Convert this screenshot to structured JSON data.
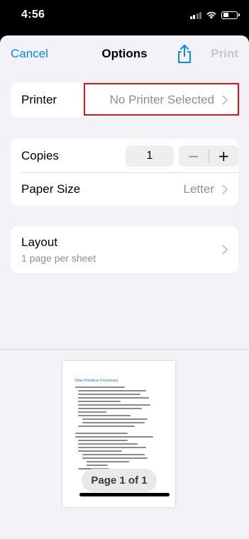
{
  "status_bar": {
    "time": "4:56"
  },
  "nav": {
    "cancel_label": "Cancel",
    "title": "Options",
    "print_label": "Print",
    "share_icon": "share-icon"
  },
  "printer": {
    "label": "Printer",
    "value": "No Printer Selected"
  },
  "copies": {
    "label": "Copies",
    "count": "1",
    "minus": "−",
    "plus": "+"
  },
  "paper_size": {
    "label": "Paper Size",
    "value": "Letter"
  },
  "layout": {
    "label": "Layout",
    "subtitle": "1 page per sheet"
  },
  "preview": {
    "heading": "New Printless Processes",
    "page_indicator": "Page 1 of 1"
  },
  "colors": {
    "accent": "#0a84ff",
    "disabled": "#c7c7cc",
    "secondary_text": "#8e8e93",
    "highlight_box": "#e01414",
    "background": "#f2f2f7"
  }
}
